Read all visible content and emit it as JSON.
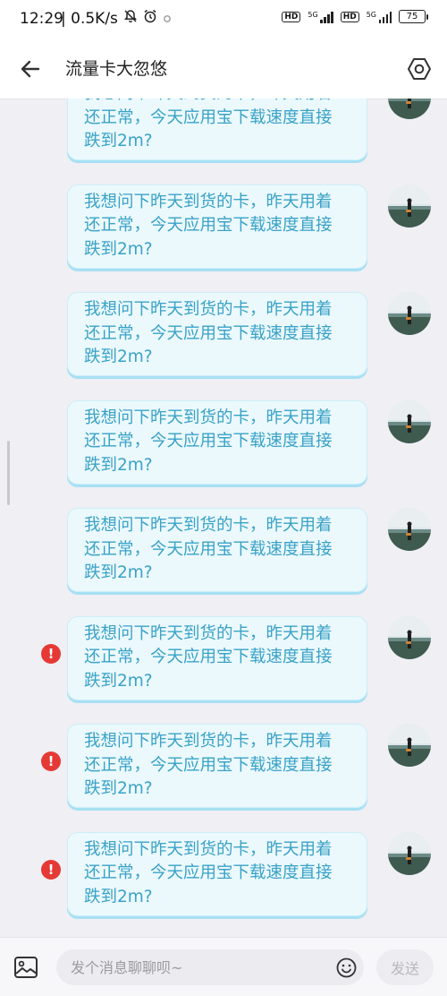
{
  "status_bar": {
    "time": "12:29",
    "net_speed": "| 0.5K/s",
    "battery": "75",
    "sim1_badge": "HD",
    "sim2_badge": "HD",
    "sim1_network": "5G",
    "sim2_network": "5G"
  },
  "header": {
    "title": "流量卡大忽悠"
  },
  "messages": [
    {
      "lines": [
        "我想问下昨天到货的卡，昨天用着",
        "还正常，今天应用宝下载速度直接",
        "跌到2m?"
      ],
      "failed": false
    },
    {
      "lines": [
        "我想问下昨天到货的卡，昨天用着",
        "还正常，今天应用宝下载速度直接",
        "跌到2m?"
      ],
      "failed": false
    },
    {
      "lines": [
        "我想问下昨天到货的卡，昨天用着",
        "还正常，今天应用宝下载速度直接",
        "跌到2m?"
      ],
      "failed": false
    },
    {
      "lines": [
        "我想问下昨天到货的卡，昨天用着",
        "还正常，今天应用宝下载速度直接",
        "跌到2m?"
      ],
      "failed": false
    },
    {
      "lines": [
        "我想问下昨天到货的卡，昨天用着",
        "还正常，今天应用宝下载速度直接",
        "跌到2m?"
      ],
      "failed": false
    },
    {
      "lines": [
        "我想问下昨天到货的卡，昨天用着",
        "还正常，今天应用宝下载速度直接",
        "跌到2m?"
      ],
      "failed": true
    },
    {
      "lines": [
        "我想问下昨天到货的卡，昨天用着",
        "还正常，今天应用宝下载速度直接",
        "跌到2m?"
      ],
      "failed": true
    },
    {
      "lines": [
        "我想问下昨天到货的卡，昨天用着",
        "还正常，今天应用宝下载速度直接",
        "跌到2m?"
      ],
      "failed": true
    }
  ],
  "error_mark": "!",
  "input": {
    "placeholder": "发个消息聊聊呗~",
    "send_label": "发送"
  },
  "icons": {
    "back": "back-arrow-icon",
    "settings": "settings-hexagon-icon",
    "image": "image-icon",
    "emoji": "emoji-icon",
    "error": "error-icon",
    "mute": "mute-bell-icon",
    "alarm": "alarm-clock-icon"
  },
  "colors": {
    "bubble_bg": "#ebf9fd",
    "bubble_text": "#3aa2c7",
    "error": "#e53935",
    "background": "#efeff4"
  }
}
